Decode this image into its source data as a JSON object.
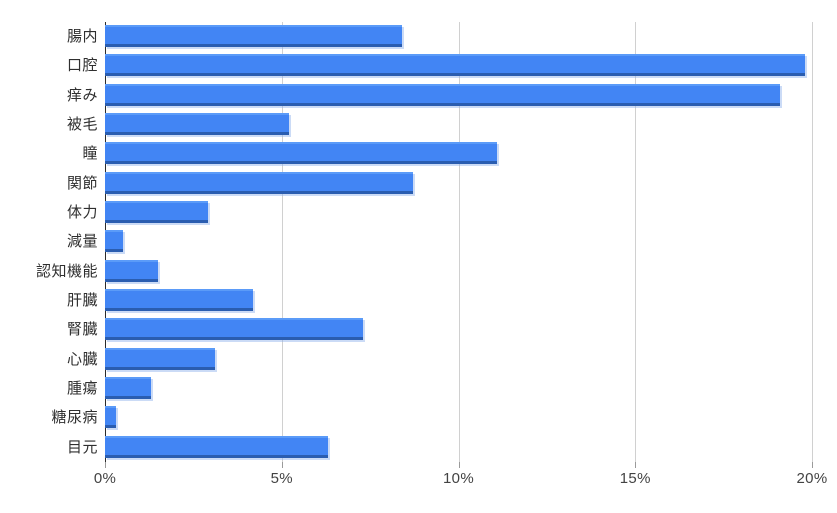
{
  "chart_data": {
    "type": "bar",
    "orientation": "horizontal",
    "title": "",
    "subtitle": "",
    "xlabel": "",
    "ylabel": "",
    "xlim": [
      0,
      20
    ],
    "xtick_labels": [
      "0%",
      "5%",
      "10%",
      "15%",
      "20%"
    ],
    "xticks": [
      0,
      5,
      10,
      15,
      20
    ],
    "grid": true,
    "legend": false,
    "legend_position": "none",
    "unit": "%",
    "bar_color": "#4285f4",
    "bar_edge_color": "#2a5db0",
    "gridline_color": "#d0d0d0",
    "axis_color": "#2b2b2b",
    "categories": [
      "腸内",
      "口腔",
      "痒み",
      "被毛",
      "瞳",
      "関節",
      "体力",
      "減量",
      "認知機能",
      "肝臓",
      "腎臓",
      "心臓",
      "腫瘍",
      "糖尿病",
      "目元"
    ],
    "values": [
      8.4,
      19.8,
      19.1,
      5.2,
      11.1,
      8.7,
      2.9,
      0.5,
      1.5,
      4.2,
      7.3,
      3.1,
      1.3,
      0.3,
      6.3
    ],
    "series": [
      {
        "name": "",
        "values": [
          8.4,
          19.8,
          19.1,
          5.2,
          11.1,
          8.7,
          2.9,
          0.5,
          1.5,
          4.2,
          7.3,
          3.1,
          1.3,
          0.3,
          6.3
        ]
      }
    ]
  }
}
